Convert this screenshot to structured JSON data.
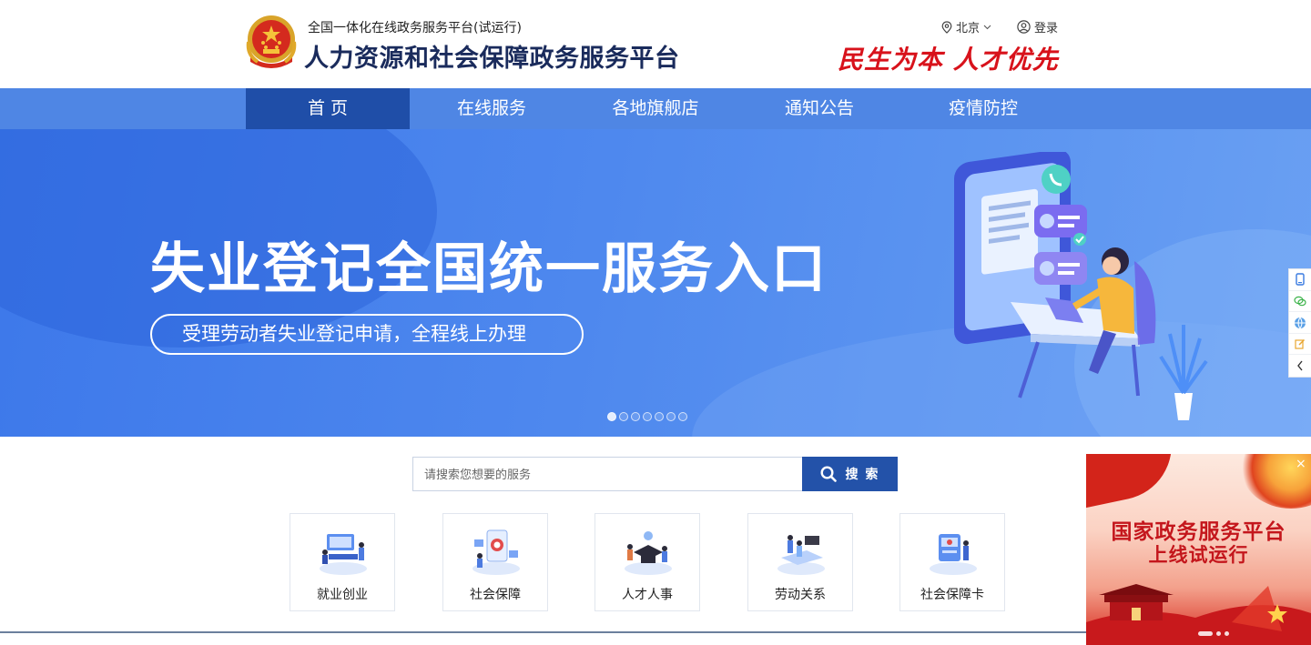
{
  "header": {
    "subtitle": "全国一体化在线政务服务平台(试运行)",
    "title": "人力资源和社会保障政务服务平台",
    "region": "北京",
    "login": "登录",
    "slogan": "民生为本 人才优先"
  },
  "nav": {
    "items": [
      {
        "label": "首 页",
        "active": true
      },
      {
        "label": "在线服务"
      },
      {
        "label": "各地旗舰店"
      },
      {
        "label": "通知公告"
      },
      {
        "label": "疫情防控"
      }
    ]
  },
  "banner": {
    "headline": "失业登记全国统一服务入口",
    "tagline": "受理劳动者失业登记申请，全程线上办理",
    "slide_count": 7,
    "active_slide": 1
  },
  "search": {
    "placeholder": "请搜索您想要的服务",
    "button": "搜 索"
  },
  "categories": [
    {
      "label": "就业创业",
      "icon": "employment-icon"
    },
    {
      "label": "社会保障",
      "icon": "social-security-icon"
    },
    {
      "label": "人才人事",
      "icon": "talent-icon"
    },
    {
      "label": "劳动关系",
      "icon": "labor-relations-icon"
    },
    {
      "label": "社会保障卡",
      "icon": "security-card-icon"
    }
  ],
  "sidebar": {
    "icons": [
      "mobile-icon",
      "wechat-icon",
      "globe-icon",
      "edit-icon",
      "collapse-arrow-icon"
    ]
  },
  "popup": {
    "line1": "国家政务服务平台",
    "line2": "上线试运行",
    "close": "×"
  },
  "colors": {
    "nav": "#4f86e4",
    "nav_active": "#1f4ea8",
    "title": "#1a2b5c",
    "slogan": "#d8121b",
    "search_button": "#2352a9",
    "banner": "#4a84ec"
  }
}
